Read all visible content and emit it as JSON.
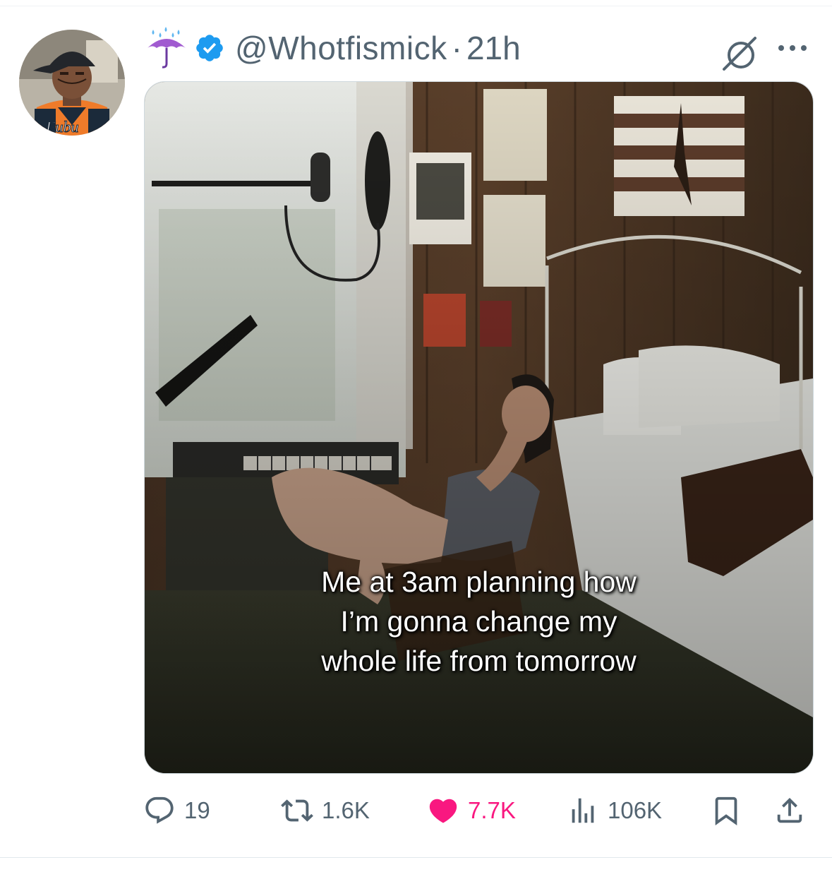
{
  "post": {
    "handle": "@Whotfismick",
    "separator": "·",
    "time": "21h",
    "caption_lines": [
      "Me at 3am planning how",
      "I’m gonna change my",
      "whole life from tomorrow"
    ]
  },
  "actions": {
    "replies": "19",
    "reposts": "1.6K",
    "likes": "7.7K",
    "views": "106K"
  },
  "icons": {
    "header": [
      "umbrella-rain-emoji",
      "verified-badge-icon",
      "grok-icon",
      "more-icon"
    ],
    "action_bar": [
      "reply-icon",
      "repost-icon",
      "like-heart-icon",
      "views-chart-icon",
      "bookmark-icon",
      "share-icon"
    ]
  },
  "colors": {
    "secondary_text": "#536471",
    "like_active": "#f91880",
    "verified": "#1d9bf0"
  }
}
